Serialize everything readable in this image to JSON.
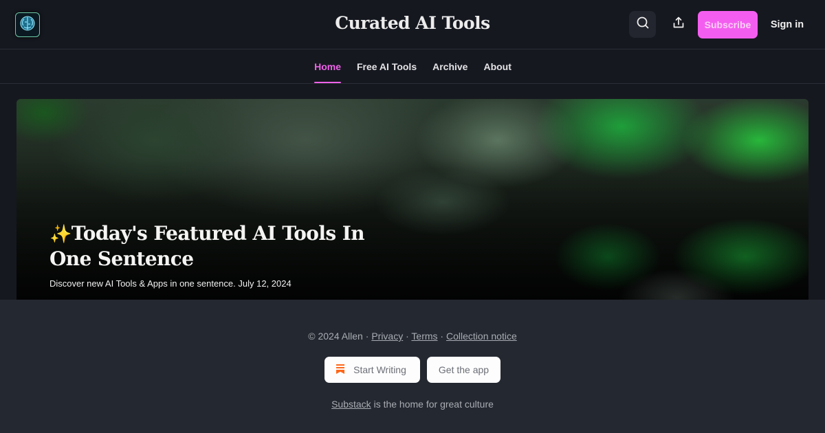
{
  "header": {
    "logo_icon": "brain-icon",
    "title": "Curated AI Tools",
    "search_icon": "search-icon",
    "share_icon": "share-icon",
    "subscribe_label": "Subscribe",
    "signin_label": "Sign in"
  },
  "nav": {
    "items": [
      {
        "label": "Home",
        "active": true
      },
      {
        "label": "Free AI Tools",
        "active": false
      },
      {
        "label": "Archive",
        "active": false
      },
      {
        "label": "About",
        "active": false
      }
    ]
  },
  "hero": {
    "emoji": "✨",
    "title": "Today's Featured AI Tools In One Sentence",
    "subtitle": "Discover new AI Tools & Apps in one sentence. July 12, 2024"
  },
  "footer": {
    "copyright": "© 2024 Allen",
    "separator": " · ",
    "links": [
      "Privacy",
      "Terms",
      "Collection notice"
    ],
    "start_writing_label": "Start Writing",
    "get_app_label": "Get the app",
    "tagline_link": "Substack",
    "tagline_rest": " is the home for great culture"
  },
  "colors": {
    "accent": "#f35ef0",
    "nav_active": "#ee62e8",
    "background": "#161820",
    "footer_background": "#242830"
  }
}
